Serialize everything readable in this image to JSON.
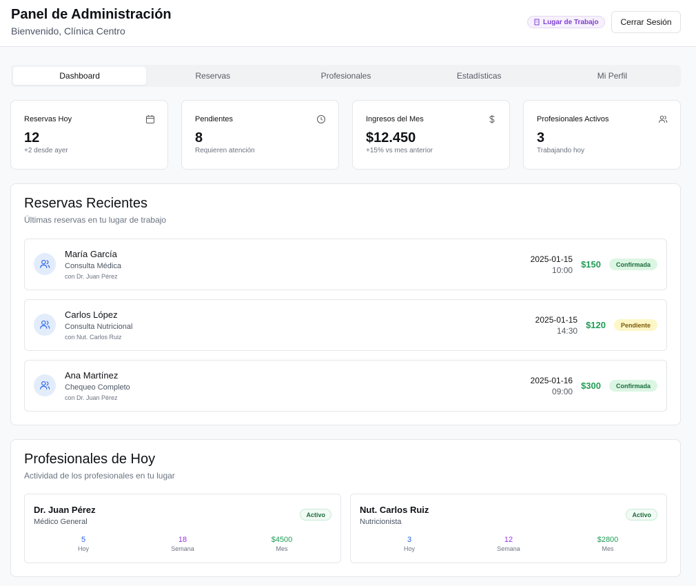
{
  "header": {
    "title": "Panel de Administración",
    "subtitle": "Bienvenido, Clínica Centro",
    "workplace_badge": "Lugar de Trabajo",
    "logout_label": "Cerrar Sesión"
  },
  "tabs": [
    {
      "label": "Dashboard",
      "active": true
    },
    {
      "label": "Reservas"
    },
    {
      "label": "Profesionales"
    },
    {
      "label": "Estadísticas"
    },
    {
      "label": "Mi Perfil"
    }
  ],
  "stats": [
    {
      "label": "Reservas Hoy",
      "value": "12",
      "note": "+2 desde ayer",
      "icon": "calendar-icon"
    },
    {
      "label": "Pendientes",
      "value": "8",
      "note": "Requieren atención",
      "icon": "clock-icon"
    },
    {
      "label": "Ingresos del Mes",
      "value": "$12.450",
      "note": "+15% vs mes anterior",
      "icon": "dollar-icon"
    },
    {
      "label": "Profesionales Activos",
      "value": "3",
      "note": "Trabajando hoy",
      "icon": "users-icon"
    }
  ],
  "recent": {
    "title": "Reservas Recientes",
    "subtitle": "Últimas reservas en tu lugar de trabajo",
    "items": [
      {
        "name": "María García",
        "service": "Consulta Médica",
        "professional": "con Dr. Juan Pérez",
        "date": "2025-01-15",
        "time": "10:00",
        "amount": "$150",
        "status": "Confirmada"
      },
      {
        "name": "Carlos López",
        "service": "Consulta Nutricional",
        "professional": "con Nut. Carlos Ruiz",
        "date": "2025-01-15",
        "time": "14:30",
        "amount": "$120",
        "status": "Pendiente"
      },
      {
        "name": "Ana Martínez",
        "service": "Chequeo Completo",
        "professional": "con Dr. Juan Pérez",
        "date": "2025-01-16",
        "time": "09:00",
        "amount": "$300",
        "status": "Confirmada"
      }
    ]
  },
  "today": {
    "title": "Profesionales de Hoy",
    "subtitle": "Actividad de los profesionales en tu lugar",
    "items": [
      {
        "name": "Dr. Juan Pérez",
        "role": "Médico General",
        "badge": "Activo",
        "today": "5",
        "today_label": "Hoy",
        "week": "18",
        "week_label": "Semana",
        "month": "$4500",
        "month_label": "Mes"
      },
      {
        "name": "Nut. Carlos Ruiz",
        "role": "Nutricionista",
        "badge": "Activo",
        "today": "3",
        "today_label": "Hoy",
        "week": "12",
        "week_label": "Semana",
        "month": "$2800",
        "month_label": "Mes"
      }
    ]
  },
  "colors": {
    "accent_green": "#1f9d55",
    "accent_blue": "#2563eb",
    "accent_purple": "#9333ea",
    "badge_purple": "#7e3fd0"
  }
}
